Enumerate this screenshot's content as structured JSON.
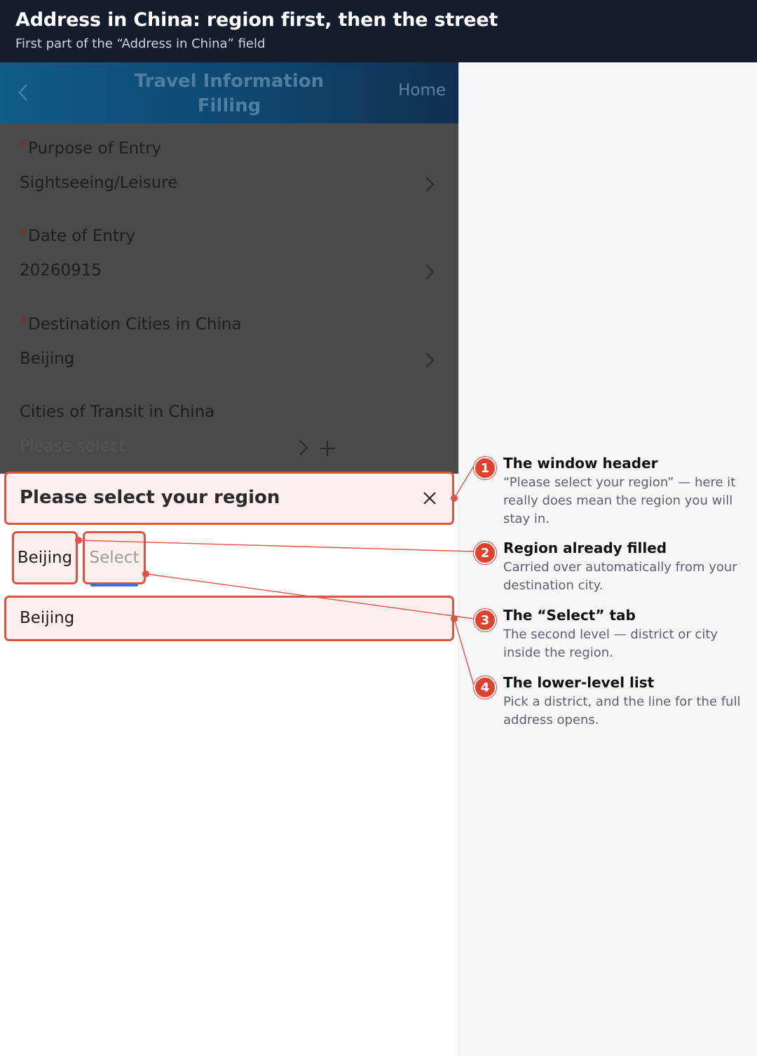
{
  "banner": {
    "title": "Address in China: region first, then the street",
    "subtitle": "First part of the “Address in China” field"
  },
  "nav": {
    "back_icon": "chevron-left-icon",
    "title": "Travel Information Filling",
    "home_label": "Home"
  },
  "form": {
    "fields": [
      {
        "label": "Purpose of Entry",
        "required": "*",
        "value": "Sightseeing/Leisure"
      },
      {
        "label": "Date of Entry",
        "required": "*",
        "value": "20260915"
      },
      {
        "label": "Destination Cities in China",
        "required": "*",
        "value": "Beijing"
      },
      {
        "label": "Cities of Transit in China",
        "placeholder": "Please select"
      }
    ]
  },
  "modal": {
    "title": "Please select your region",
    "close_icon": "close-icon",
    "tabs": [
      "Beijing",
      "Select"
    ],
    "list": [
      "Beijing"
    ]
  },
  "annotations": [
    {
      "num": "1",
      "title": "The window header",
      "text": "“Please select your region” — here it really does mean the region you will stay in."
    },
    {
      "num": "2",
      "title": "Region already filled",
      "text": "Carried over automatically from your destination city."
    },
    {
      "num": "3",
      "title": "The “Select” tab",
      "text": "The second level — district or city inside the region."
    },
    {
      "num": "4",
      "title": "The lower-level list",
      "text": "Pick a district, and the line for the full address opens."
    }
  ],
  "colors": {
    "highlight": "#e05242",
    "banner": "#131d2e",
    "active_tab_underline": "#3b73d3"
  }
}
